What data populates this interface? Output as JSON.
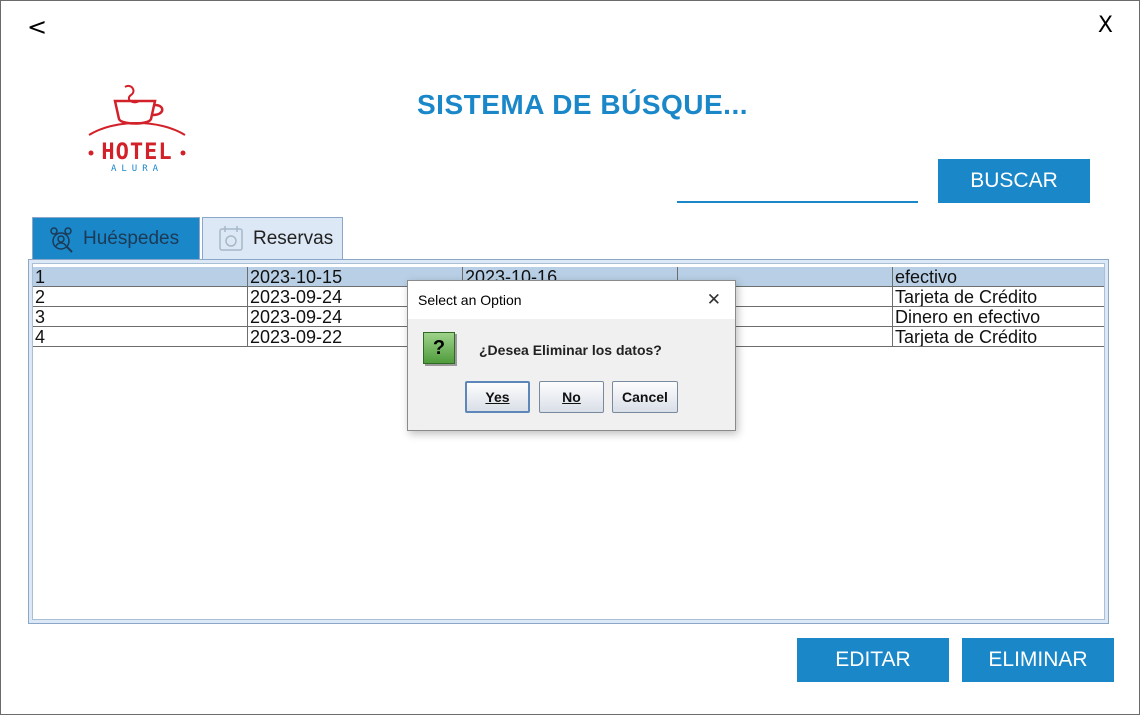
{
  "nav": {
    "back_label": "<",
    "close_label": "X"
  },
  "logo": {
    "text_top": "HOTEL",
    "text_bottom": "ALURA",
    "brand_color": "#d3212a",
    "accent_color": "#1a87c9"
  },
  "title": "SISTEMA DE BÚSQUE...",
  "search": {
    "value": "",
    "button_label": "BUSCAR"
  },
  "tabs": [
    {
      "label": "Huéspedes",
      "icon": "guests-icon",
      "active": false
    },
    {
      "label": "Reservas",
      "icon": "reservations-icon",
      "active": true
    }
  ],
  "table": {
    "rows": [
      [
        "1",
        "2023-10-15",
        "2023-10-16",
        "",
        "efectivo"
      ],
      [
        "2",
        "2023-09-24",
        "",
        "",
        "Tarjeta de Crédito"
      ],
      [
        "3",
        "2023-09-24",
        "",
        "",
        "Dinero en efectivo"
      ],
      [
        "4",
        "2023-09-22",
        "",
        "",
        "Tarjeta de Crédito"
      ]
    ],
    "selected_row": 0
  },
  "actions": {
    "edit_label": "EDITAR",
    "delete_label": "ELIMINAR"
  },
  "dialog": {
    "title": "Select an Option",
    "close_label": "✕",
    "icon": "question-icon",
    "icon_glyph": "?",
    "message": "¿Desea Eliminar los datos?",
    "yes_label": "Yes",
    "no_label": "No",
    "cancel_label": "Cancel"
  },
  "colors": {
    "primary": "#1a87c9",
    "selected_row": "#b8cfe5",
    "tab_inactive": "#dce8f5"
  }
}
